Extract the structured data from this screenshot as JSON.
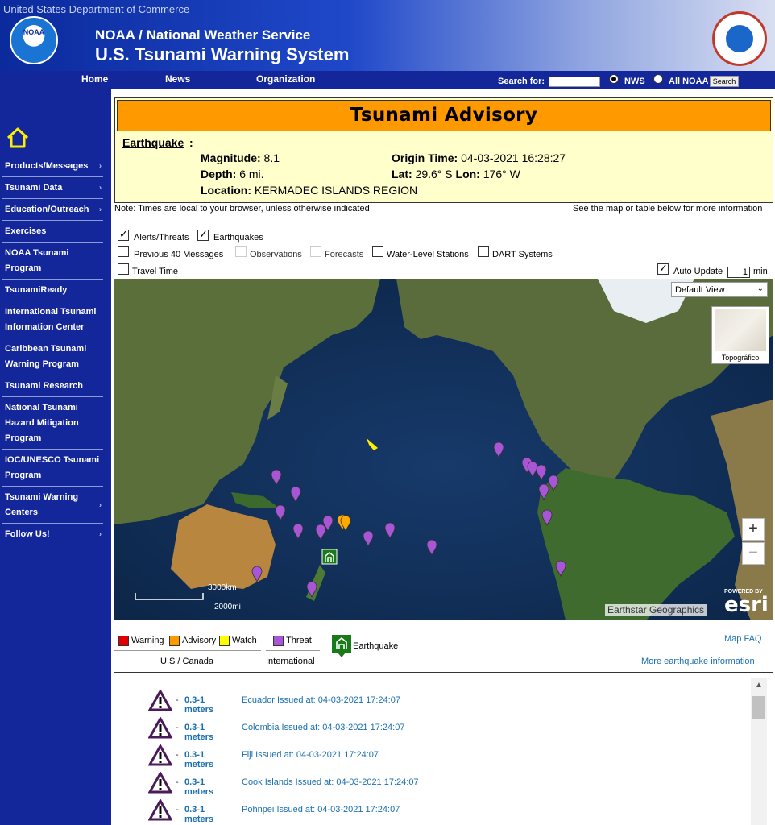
{
  "header": {
    "department": "United States Department of Commerce",
    "noaa_logo_text": "NOAA",
    "agency": "NOAA / National Weather Service",
    "system": "U.S. Tsunami Warning System"
  },
  "nav": {
    "home": "Home",
    "news": "News",
    "organization": "Organization",
    "search_label": "Search for:",
    "search_value": "",
    "radio_nws": "NWS",
    "radio_all": "All NOAA",
    "search_button": "Search"
  },
  "sidebar": {
    "items": [
      {
        "label": "Products/Messages",
        "arrow": "›"
      },
      {
        "label": "Tsunami Data",
        "arrow": "›"
      },
      {
        "label": "Education/Outreach",
        "arrow": "›"
      },
      {
        "label": "Exercises",
        "arrow": ""
      },
      {
        "label": "NOAA Tsunami Program",
        "arrow": ""
      },
      {
        "label": "TsunamiReady",
        "arrow": ""
      },
      {
        "label": "International Tsunami Information Center",
        "arrow": ""
      },
      {
        "label": "Caribbean Tsunami Warning Program",
        "arrow": ""
      },
      {
        "label": "Tsunami Research",
        "arrow": ""
      },
      {
        "label": "National Tsunami Hazard Mitigation Program",
        "arrow": ""
      },
      {
        "label": "IOC/UNESCO Tsunami Program",
        "arrow": ""
      },
      {
        "label": "Tsunami Warning Centers",
        "arrow": "›"
      },
      {
        "label": "Follow Us!",
        "arrow": "›"
      }
    ]
  },
  "advisory": {
    "title": "Tsunami Advisory",
    "heading": "Earthquake",
    "colon": ":",
    "magnitude_label": "Magnitude:",
    "magnitude": "8.1",
    "depth_label": "Depth:",
    "depth": "6 mi.",
    "location_label": "Location:",
    "location": "KERMADEC ISLANDS REGION",
    "origin_label": "Origin Time:",
    "origin": "04-03-2021 16:28:27",
    "lat_label": "Lat:",
    "lat": "29.6° S",
    "lon_label": "Lon:",
    "lon": "176° W",
    "note_left": "Note: Times are local to your browser, unless otherwise indicated",
    "note_right": "See the map or table below for more information"
  },
  "filters": {
    "alerts": {
      "label": "Alerts/Threats",
      "checked": true
    },
    "earthquakes": {
      "label": "Earthquakes",
      "checked": true
    },
    "previous": {
      "label": "Previous 40 Messages",
      "checked": false
    },
    "observations": {
      "label": "Observations",
      "checked": false
    },
    "forecasts": {
      "label": "Forecasts",
      "checked": false
    },
    "water_level": {
      "label": "Water-Level Stations",
      "checked": false
    },
    "dart": {
      "label": "DART Systems",
      "checked": false
    },
    "travel_time": {
      "label": "Travel Time",
      "checked": false
    },
    "auto_update": {
      "label": "Auto Update",
      "checked": true,
      "value": "1",
      "unit": "min"
    }
  },
  "map": {
    "view_select": "Default View",
    "basemap_label": "Topográfico",
    "zoom_in": "+",
    "zoom_out": "−",
    "scale_km": "3000km",
    "scale_mi": "2000mi",
    "attribution": "Earthstar Geographics",
    "esri_powered": "POWERED BY",
    "esri": "esri",
    "colors": {
      "threat": "#a855d6",
      "advisory": "#ffaa00",
      "watch": "#ffee00",
      "earthquake": "#1a7a1a"
    }
  },
  "legend": {
    "warning": {
      "label": "Warning",
      "color": "#e00000"
    },
    "advisory": {
      "label": "Advisory",
      "color": "#ff9900"
    },
    "watch": {
      "label": "Watch",
      "color": "#ffff00"
    },
    "threat": {
      "label": "Threat",
      "color": "#a855d6"
    },
    "us_canada": "U.S / Canada",
    "international": "International",
    "earthquake": "Earthquake",
    "map_faq": "Map FAQ",
    "more_eq": "More earthquake information"
  },
  "threats": [
    {
      "amount": "0.3-1 meters",
      "place": "Ecuador",
      "issued": "Issued at: 04-03-2021 17:24:07"
    },
    {
      "amount": "0.3-1 meters",
      "place": "Colombia",
      "issued": "Issued at: 04-03-2021 17:24:07"
    },
    {
      "amount": "0.3-1 meters",
      "place": "Fiji",
      "issued": "Issued at: 04-03-2021 17:24:07"
    },
    {
      "amount": "0.3-1 meters",
      "place": "Cook Islands",
      "issued": "Issued at: 04-03-2021 17:24:07"
    },
    {
      "amount": "0.3-1 meters",
      "place": "Pohnpei",
      "issued": "Issued at: 04-03-2021 17:24:07"
    }
  ],
  "threat_dash": "-",
  "scroll_up": "▲"
}
